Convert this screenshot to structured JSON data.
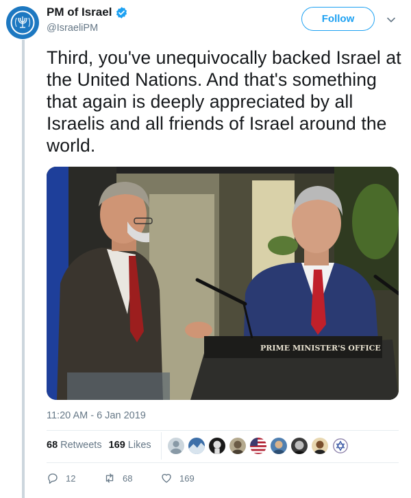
{
  "author": {
    "display_name": "PM of Israel",
    "handle": "@IsraeliPM",
    "verified": true,
    "avatar_icon": "emblem-of-israel-icon"
  },
  "follow_button_label": "Follow",
  "tweet": {
    "text": "Third, you've unequivocally backed Israel at the United Nations. And that's something that again is deeply appreciated by all Israelis and all friends of Israel around the world.",
    "timestamp": "11:20 AM - 6 Jan 2019"
  },
  "media": {
    "podium_text": "PRIME MINISTER'S OFFICE"
  },
  "stats": {
    "retweets_count": "68",
    "retweets_label": "Retweets",
    "likes_count": "169",
    "likes_label": "Likes"
  },
  "actions": {
    "reply_count": "12",
    "retweet_count": "68",
    "like_count": "169"
  },
  "colors": {
    "accent": "#1da1f2",
    "secondary_text": "#657786",
    "avatar_bg": "#1d78c1"
  }
}
